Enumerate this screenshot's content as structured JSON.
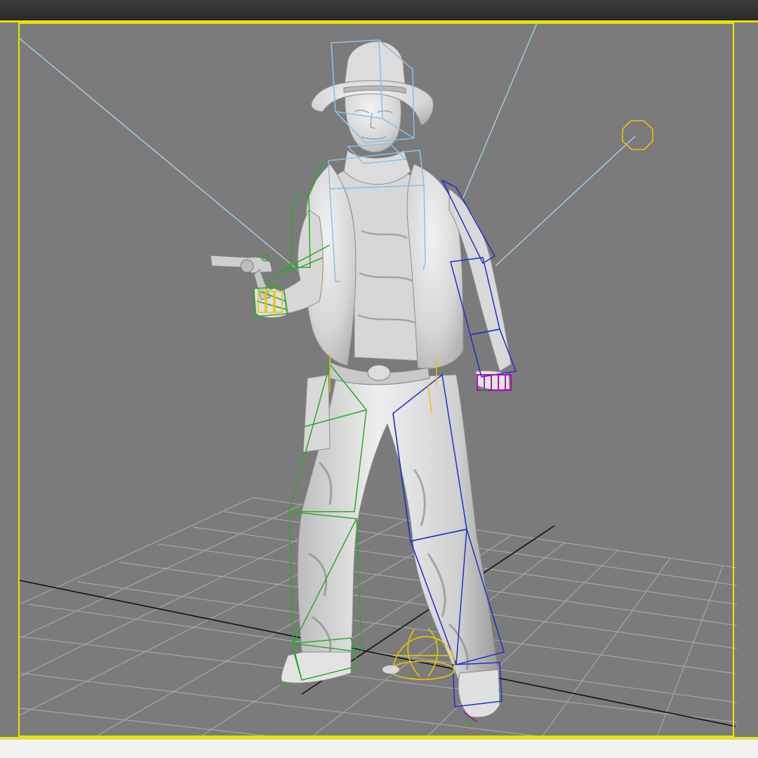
{
  "app": {
    "type": "3d-modeling-viewport",
    "view": "perspective",
    "shading": "smooth-shaded"
  },
  "viewport": {
    "active": true,
    "grid_visible": true,
    "active_border_color": "#e6e600",
    "background_color": "#7c7c7c"
  },
  "scene": {
    "model": "cowboy-character-mesh",
    "rig": "biped",
    "held_prop": "revolver",
    "bone_colors": {
      "left_side": "#2ea82e",
      "right_side": "#2030c8",
      "head_spine": "#8fc0e0",
      "selected_helper": "#e0c800",
      "right_hand": "#b000b0"
    },
    "helpers": [
      "circle-target-helper",
      "root-dome-helper"
    ]
  }
}
